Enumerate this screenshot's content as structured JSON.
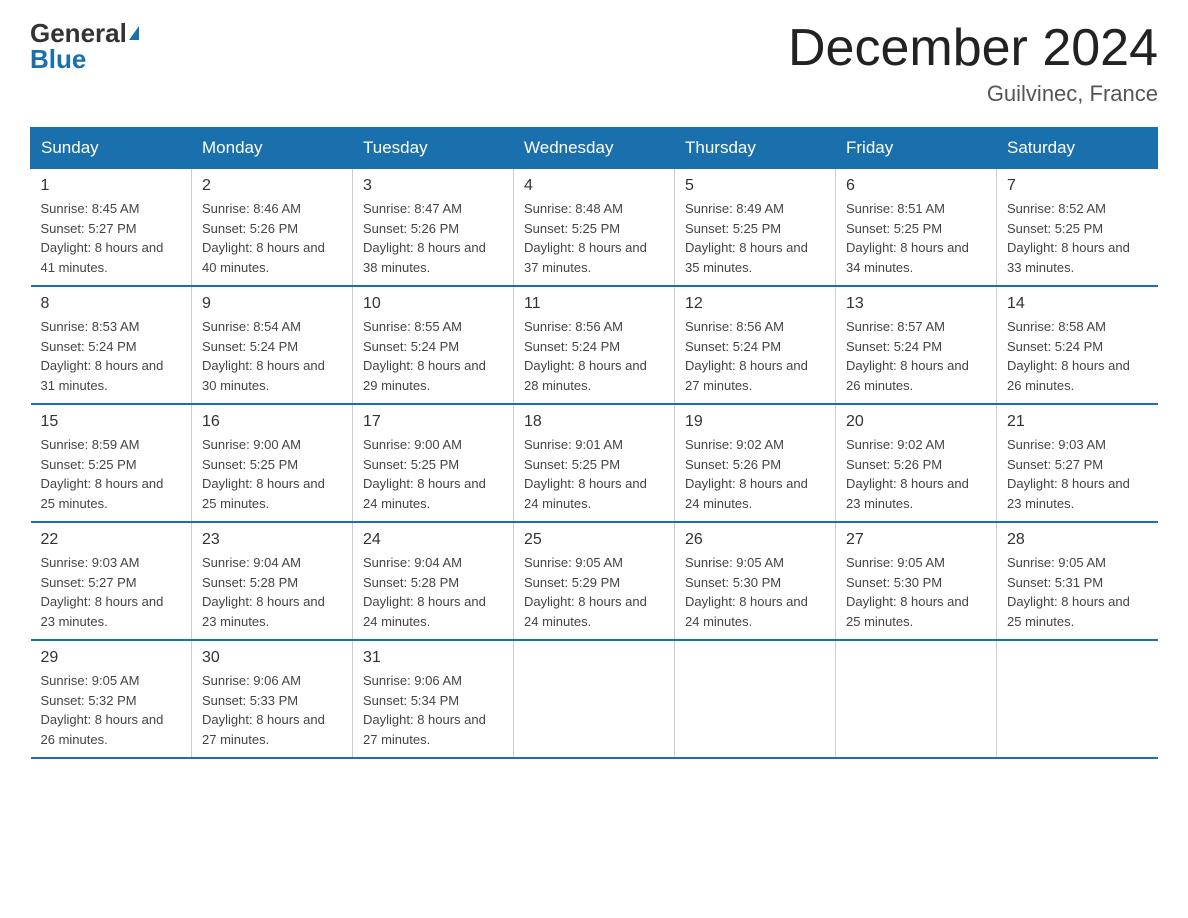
{
  "header": {
    "logo_general": "General",
    "logo_blue": "Blue",
    "title": "December 2024",
    "subtitle": "Guilvinec, France"
  },
  "days_of_week": [
    "Sunday",
    "Monday",
    "Tuesday",
    "Wednesday",
    "Thursday",
    "Friday",
    "Saturday"
  ],
  "weeks": [
    [
      {
        "day": "1",
        "sunrise": "8:45 AM",
        "sunset": "5:27 PM",
        "daylight": "8 hours and 41 minutes."
      },
      {
        "day": "2",
        "sunrise": "8:46 AM",
        "sunset": "5:26 PM",
        "daylight": "8 hours and 40 minutes."
      },
      {
        "day": "3",
        "sunrise": "8:47 AM",
        "sunset": "5:26 PM",
        "daylight": "8 hours and 38 minutes."
      },
      {
        "day": "4",
        "sunrise": "8:48 AM",
        "sunset": "5:25 PM",
        "daylight": "8 hours and 37 minutes."
      },
      {
        "day": "5",
        "sunrise": "8:49 AM",
        "sunset": "5:25 PM",
        "daylight": "8 hours and 35 minutes."
      },
      {
        "day": "6",
        "sunrise": "8:51 AM",
        "sunset": "5:25 PM",
        "daylight": "8 hours and 34 minutes."
      },
      {
        "day": "7",
        "sunrise": "8:52 AM",
        "sunset": "5:25 PM",
        "daylight": "8 hours and 33 minutes."
      }
    ],
    [
      {
        "day": "8",
        "sunrise": "8:53 AM",
        "sunset": "5:24 PM",
        "daylight": "8 hours and 31 minutes."
      },
      {
        "day": "9",
        "sunrise": "8:54 AM",
        "sunset": "5:24 PM",
        "daylight": "8 hours and 30 minutes."
      },
      {
        "day": "10",
        "sunrise": "8:55 AM",
        "sunset": "5:24 PM",
        "daylight": "8 hours and 29 minutes."
      },
      {
        "day": "11",
        "sunrise": "8:56 AM",
        "sunset": "5:24 PM",
        "daylight": "8 hours and 28 minutes."
      },
      {
        "day": "12",
        "sunrise": "8:56 AM",
        "sunset": "5:24 PM",
        "daylight": "8 hours and 27 minutes."
      },
      {
        "day": "13",
        "sunrise": "8:57 AM",
        "sunset": "5:24 PM",
        "daylight": "8 hours and 26 minutes."
      },
      {
        "day": "14",
        "sunrise": "8:58 AM",
        "sunset": "5:24 PM",
        "daylight": "8 hours and 26 minutes."
      }
    ],
    [
      {
        "day": "15",
        "sunrise": "8:59 AM",
        "sunset": "5:25 PM",
        "daylight": "8 hours and 25 minutes."
      },
      {
        "day": "16",
        "sunrise": "9:00 AM",
        "sunset": "5:25 PM",
        "daylight": "8 hours and 25 minutes."
      },
      {
        "day": "17",
        "sunrise": "9:00 AM",
        "sunset": "5:25 PM",
        "daylight": "8 hours and 24 minutes."
      },
      {
        "day": "18",
        "sunrise": "9:01 AM",
        "sunset": "5:25 PM",
        "daylight": "8 hours and 24 minutes."
      },
      {
        "day": "19",
        "sunrise": "9:02 AM",
        "sunset": "5:26 PM",
        "daylight": "8 hours and 24 minutes."
      },
      {
        "day": "20",
        "sunrise": "9:02 AM",
        "sunset": "5:26 PM",
        "daylight": "8 hours and 23 minutes."
      },
      {
        "day": "21",
        "sunrise": "9:03 AM",
        "sunset": "5:27 PM",
        "daylight": "8 hours and 23 minutes."
      }
    ],
    [
      {
        "day": "22",
        "sunrise": "9:03 AM",
        "sunset": "5:27 PM",
        "daylight": "8 hours and 23 minutes."
      },
      {
        "day": "23",
        "sunrise": "9:04 AM",
        "sunset": "5:28 PM",
        "daylight": "8 hours and 23 minutes."
      },
      {
        "day": "24",
        "sunrise": "9:04 AM",
        "sunset": "5:28 PM",
        "daylight": "8 hours and 24 minutes."
      },
      {
        "day": "25",
        "sunrise": "9:05 AM",
        "sunset": "5:29 PM",
        "daylight": "8 hours and 24 minutes."
      },
      {
        "day": "26",
        "sunrise": "9:05 AM",
        "sunset": "5:30 PM",
        "daylight": "8 hours and 24 minutes."
      },
      {
        "day": "27",
        "sunrise": "9:05 AM",
        "sunset": "5:30 PM",
        "daylight": "8 hours and 25 minutes."
      },
      {
        "day": "28",
        "sunrise": "9:05 AM",
        "sunset": "5:31 PM",
        "daylight": "8 hours and 25 minutes."
      }
    ],
    [
      {
        "day": "29",
        "sunrise": "9:05 AM",
        "sunset": "5:32 PM",
        "daylight": "8 hours and 26 minutes."
      },
      {
        "day": "30",
        "sunrise": "9:06 AM",
        "sunset": "5:33 PM",
        "daylight": "8 hours and 27 minutes."
      },
      {
        "day": "31",
        "sunrise": "9:06 AM",
        "sunset": "5:34 PM",
        "daylight": "8 hours and 27 minutes."
      },
      null,
      null,
      null,
      null
    ]
  ],
  "labels": {
    "sunrise": "Sunrise:",
    "sunset": "Sunset:",
    "daylight": "Daylight:"
  }
}
